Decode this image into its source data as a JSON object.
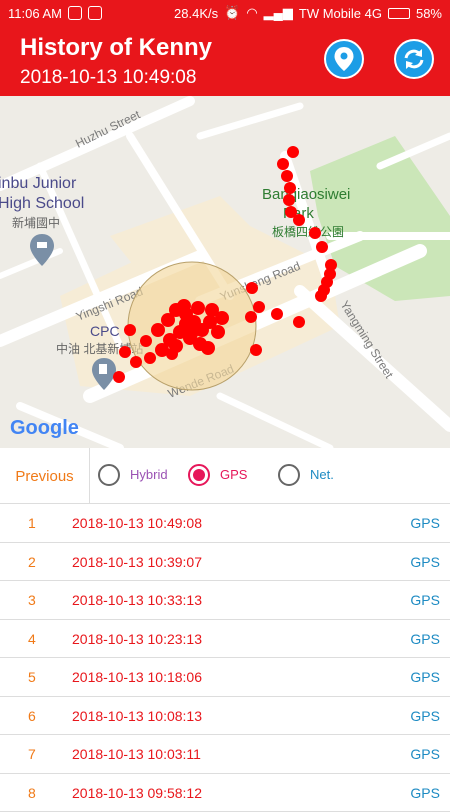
{
  "status_bar": {
    "time": "11:06 AM",
    "speed": "28.4K/s",
    "carrier": "TW Mobile 4G",
    "battery": "58%"
  },
  "header": {
    "title": "History of Kenny",
    "subtitle": "2018-10-13 10:49:08"
  },
  "map": {
    "labels": {
      "huzhu": "Huzhu Street",
      "school1": "inbu Junior",
      "school2": "High School",
      "school_zh": "新埔國中",
      "park1": "Banqiaosiwei",
      "park2": "Park",
      "park_zh": "板橋四維公園",
      "yunsheng": "Yunsheng Road",
      "yingshi": "Yingshi Road",
      "cpc": "CPC",
      "cpc_zh": "中油 北基新埔站",
      "wende": "Wende Road",
      "yangming": "Yangming Street",
      "google": "Google"
    }
  },
  "tabs": {
    "previous": "Previous",
    "hybrid": "Hybrid",
    "gps": "GPS",
    "net": "Net.",
    "selected": "gps"
  },
  "records": [
    {
      "index": "1",
      "time": "2018-10-13 10:49:08",
      "source": "GPS"
    },
    {
      "index": "2",
      "time": "2018-10-13 10:39:07",
      "source": "GPS"
    },
    {
      "index": "3",
      "time": "2018-10-13 10:33:13",
      "source": "GPS"
    },
    {
      "index": "4",
      "time": "2018-10-13 10:23:13",
      "source": "GPS"
    },
    {
      "index": "5",
      "time": "2018-10-13 10:18:06",
      "source": "GPS"
    },
    {
      "index": "6",
      "time": "2018-10-13 10:08:13",
      "source": "GPS"
    },
    {
      "index": "7",
      "time": "2018-10-13 10:03:11",
      "source": "GPS"
    },
    {
      "index": "8",
      "time": "2018-10-13 09:58:12",
      "source": "GPS"
    }
  ]
}
